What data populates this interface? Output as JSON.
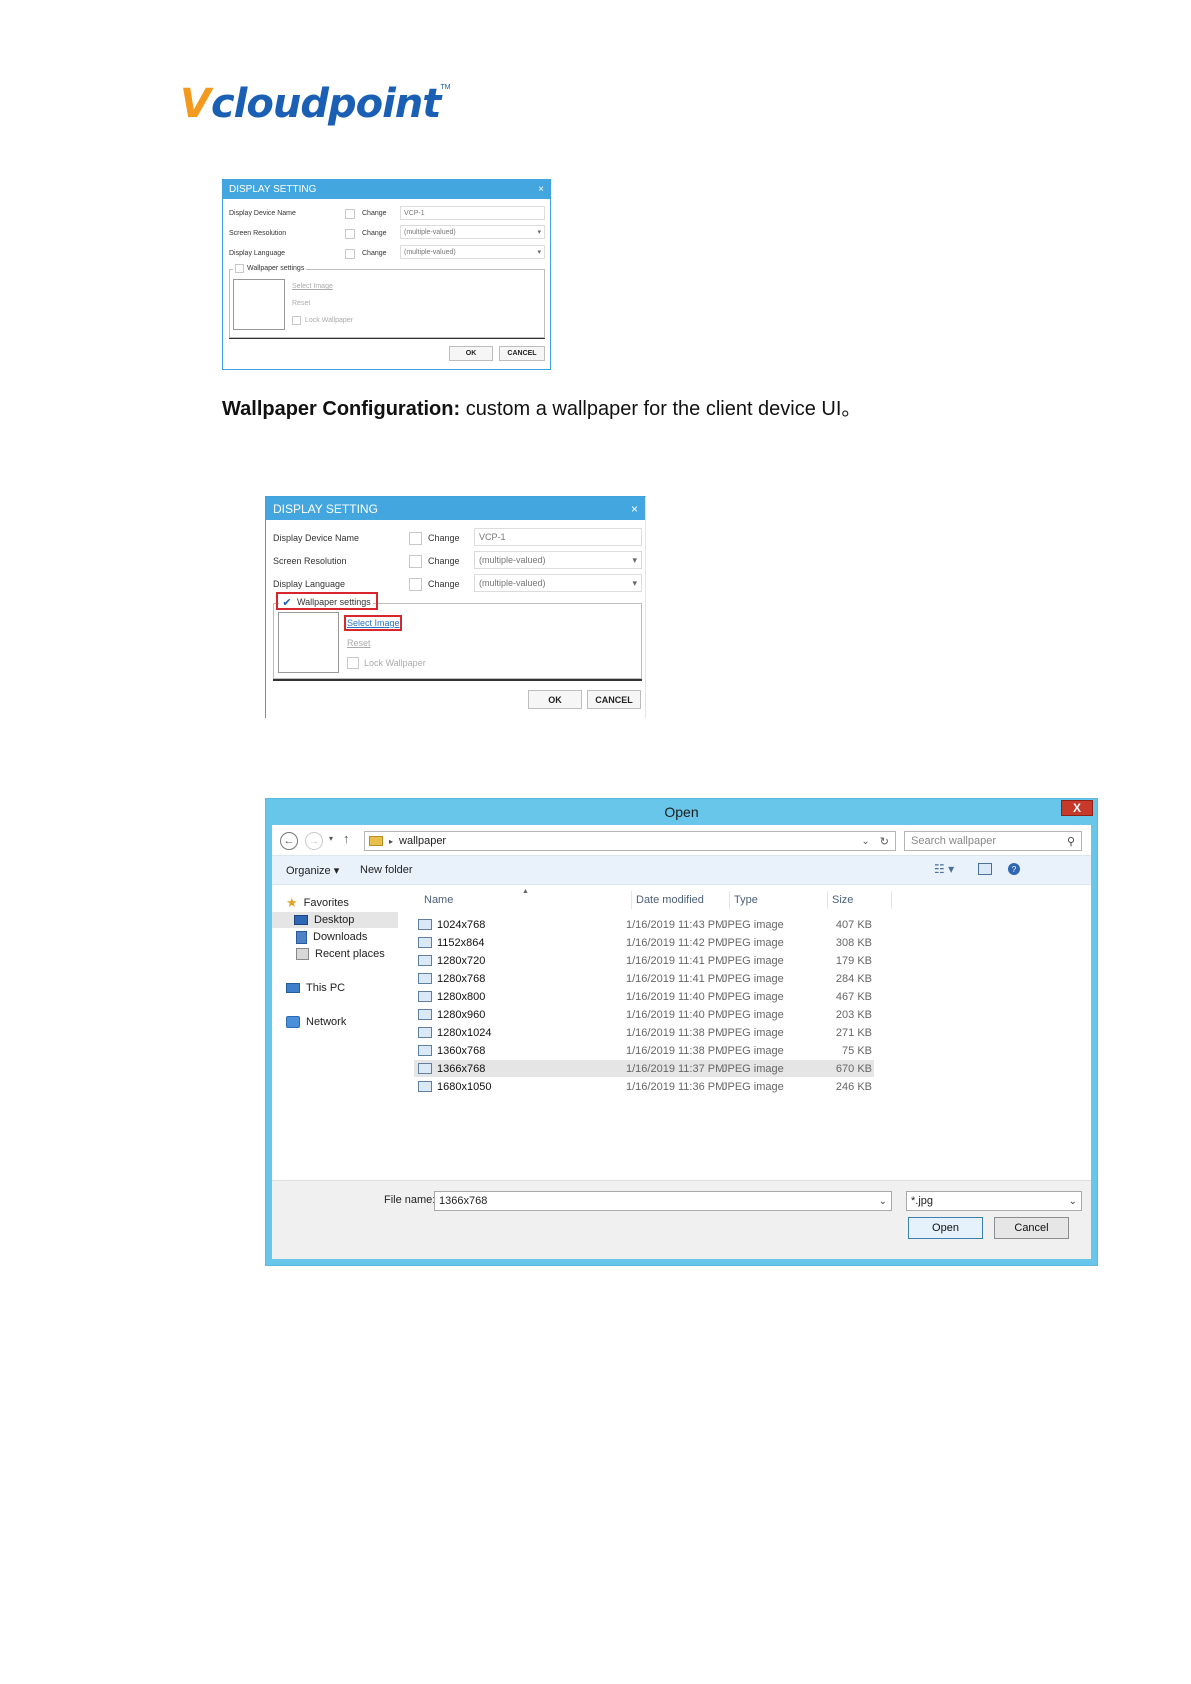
{
  "logo": {
    "v": "V",
    "word": "cloudpoint",
    "tm": "TM"
  },
  "dialog": {
    "title": "DISPLAY SETTING",
    "close": "×",
    "rows": [
      {
        "label": "Display Device Name",
        "change": "Change",
        "value": "VCP-1"
      },
      {
        "label": "Screen Resolution",
        "change": "Change",
        "value": "(multiple-valued)"
      },
      {
        "label": "Display Language",
        "change": "Change",
        "value": "(multiple-valued)"
      }
    ],
    "dropdown_caret": "▾",
    "wallpaper_settings": "Wallpaper settings",
    "select_image": "Select Image",
    "reset": "Reset",
    "lock_wallpaper": "Lock Wallpaper",
    "ok": "OK",
    "cancel": "CANCEL",
    "checkmark": "✔"
  },
  "caption": {
    "bold": "Wallpaper Configuration:",
    "text": " custom a wallpaper for the client device UI。"
  },
  "open_dialog": {
    "title": "Open",
    "close": "X",
    "address": "wallpaper",
    "search_placeholder": "Search wallpaper",
    "toolbar": {
      "organize": "Organize ▾",
      "new_folder": "New folder"
    },
    "nav": {
      "favorites": "Favorites",
      "desktop": "Desktop",
      "downloads": "Downloads",
      "recent": "Recent places",
      "this_pc": "This PC",
      "network": "Network"
    },
    "columns": {
      "name": "Name",
      "date": "Date modified",
      "type": "Type",
      "size": "Size"
    },
    "files": [
      {
        "name": "1024x768",
        "date": "1/16/2019 11:43 PM",
        "type": "JPEG image",
        "size": "407 KB"
      },
      {
        "name": "1152x864",
        "date": "1/16/2019 11:42 PM",
        "type": "JPEG image",
        "size": "308 KB"
      },
      {
        "name": "1280x720",
        "date": "1/16/2019 11:41 PM",
        "type": "JPEG image",
        "size": "179 KB"
      },
      {
        "name": "1280x768",
        "date": "1/16/2019 11:41 PM",
        "type": "JPEG image",
        "size": "284 KB"
      },
      {
        "name": "1280x800",
        "date": "1/16/2019 11:40 PM",
        "type": "JPEG image",
        "size": "467 KB"
      },
      {
        "name": "1280x960",
        "date": "1/16/2019 11:40 PM",
        "type": "JPEG image",
        "size": "203 KB"
      },
      {
        "name": "1280x1024",
        "date": "1/16/2019 11:38 PM",
        "type": "JPEG image",
        "size": "271 KB"
      },
      {
        "name": "1360x768",
        "date": "1/16/2019 11:38 PM",
        "type": "JPEG image",
        "size": "75 KB"
      },
      {
        "name": "1366x768",
        "date": "1/16/2019 11:37 PM",
        "type": "JPEG image",
        "size": "670 KB"
      },
      {
        "name": "1680x1050",
        "date": "1/16/2019 11:36 PM",
        "type": "JPEG image",
        "size": "246 KB"
      }
    ],
    "selected_index": 8,
    "file_name_label": "File name:",
    "file_name_value": "1366x768",
    "filter_value": "*.jpg",
    "open_button": "Open",
    "cancel_button": "Cancel"
  }
}
